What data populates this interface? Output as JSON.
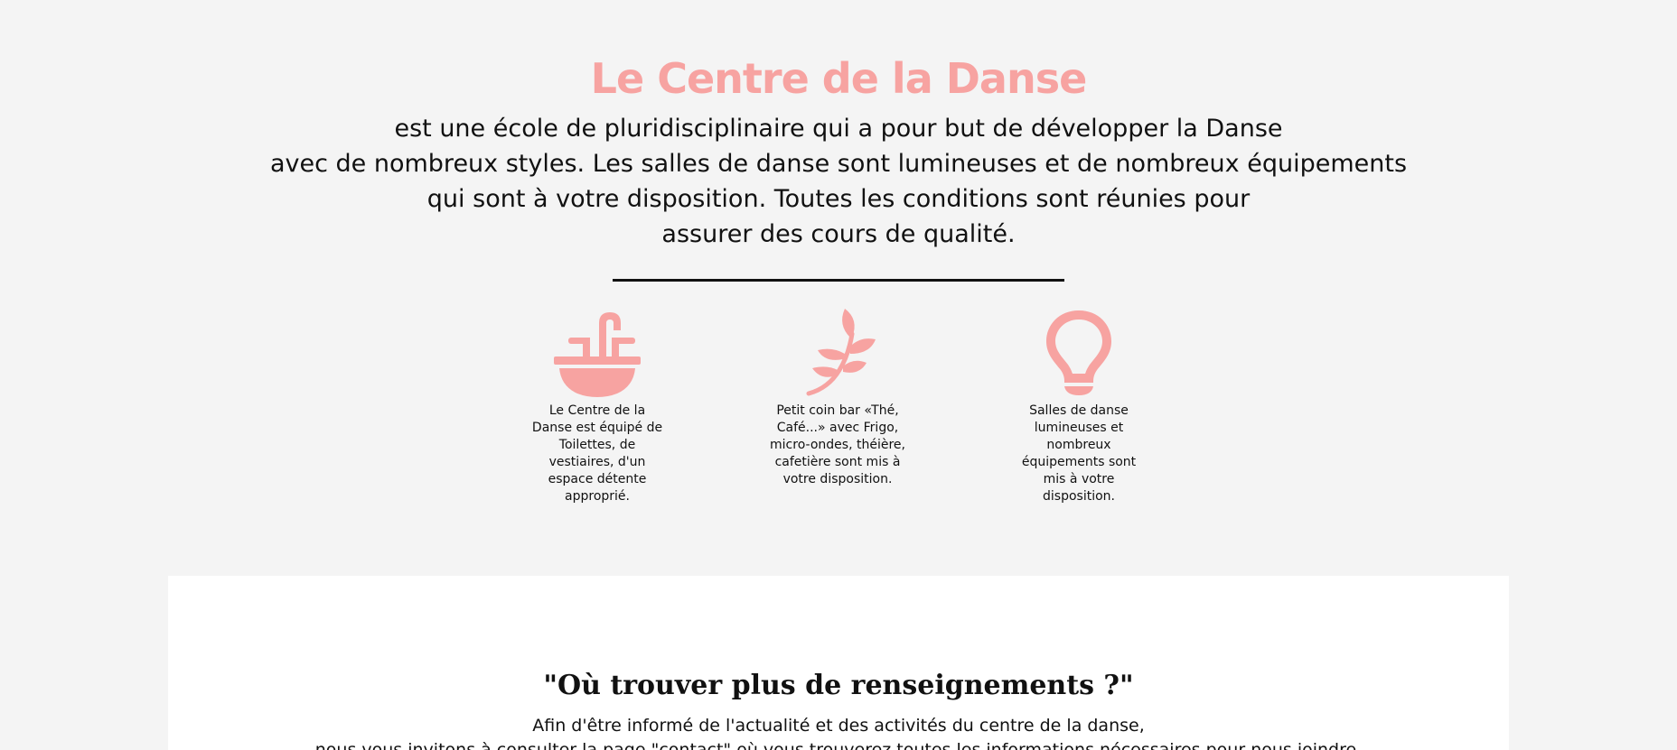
{
  "hero": {
    "title": "Le Centre de la Danse",
    "description_lines": [
      "est une école de pluridisciplinaire qui a pour but de développer la Danse",
      "avec de nombreux styles. Les salles de danse sont lumineuses et de nombreux équipements",
      "qui sont à votre disposition. Toutes les conditions sont réunies pour",
      "assurer des cours de qualité."
    ]
  },
  "features": [
    {
      "icon": "sink-icon",
      "text": "Le Centre de la Danse est équipé de Toilettes, de vestiaires, d'un espace détente approprié."
    },
    {
      "icon": "leaf-icon",
      "text": "Petit coin bar «Thé, Café...» avec Frigo, micro-ondes, théière, cafetière sont mis à votre disposition."
    },
    {
      "icon": "lightbulb-icon",
      "text": "Salles de danse lumineuses et nombreux équipements sont mis à votre disposition."
    }
  ],
  "info": {
    "title": "\"Où trouver plus de renseignements ?\"",
    "lines": [
      "Afin d'être informé de l'actualité et des activités du centre de la danse,",
      "nous vous invitons à consulter la page \"contact\" où vous trouverez toutes les informations nécessaires pour nous joindre."
    ]
  },
  "colors": {
    "accent": "#f7a3a1",
    "background": "#f4f4f4",
    "panel": "#ffffff",
    "text": "#111111"
  }
}
